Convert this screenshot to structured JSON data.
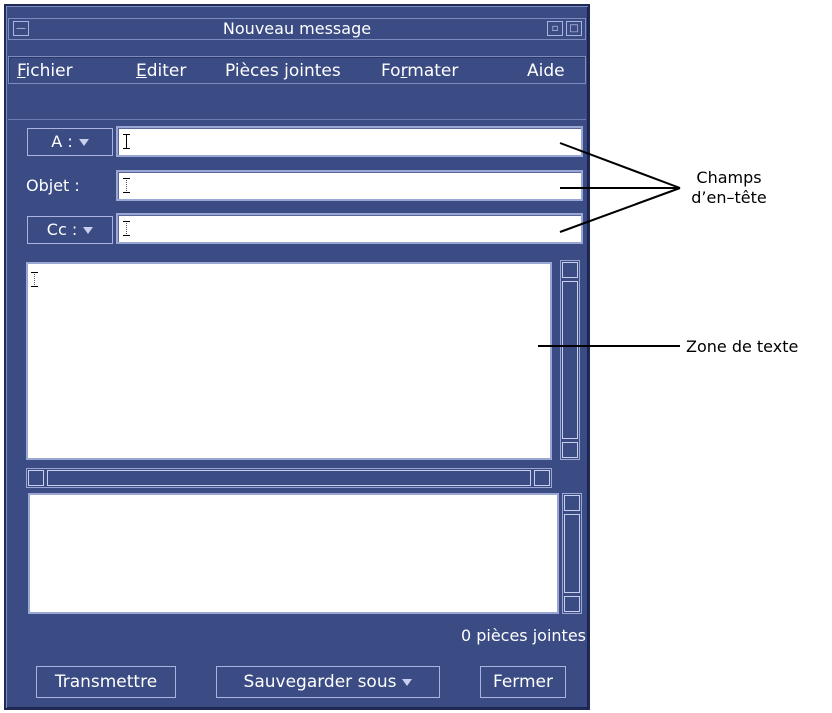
{
  "window": {
    "title": "Nouveau message"
  },
  "menu": [
    {
      "accel": "F",
      "rest": "ichier"
    },
    {
      "accel": "E",
      "rest": "diter"
    },
    {
      "accel": "",
      "rest": "Pièces jointes"
    },
    {
      "pre": "Fo",
      "accel": "r",
      "rest": "mater"
    },
    {
      "accel": "",
      "rest": "Aide"
    }
  ],
  "header": {
    "to_label": "A :",
    "subject_label": "Objet :",
    "cc_label": "Cc :",
    "to_value": "",
    "subject_value": "",
    "cc_value": ""
  },
  "attachments": {
    "count_text": "0 pièces jointes"
  },
  "buttons": {
    "send": "Transmettre",
    "save_as": "Sauvegarder sous",
    "close": "Fermer"
  },
  "annotations": {
    "header_fields_line1": "Champs",
    "header_fields_line2": "d’en–tête",
    "text_zone": "Zone de texte"
  },
  "colors": {
    "window_bg": "#3b4b84",
    "field_bg": "#ffffff"
  }
}
